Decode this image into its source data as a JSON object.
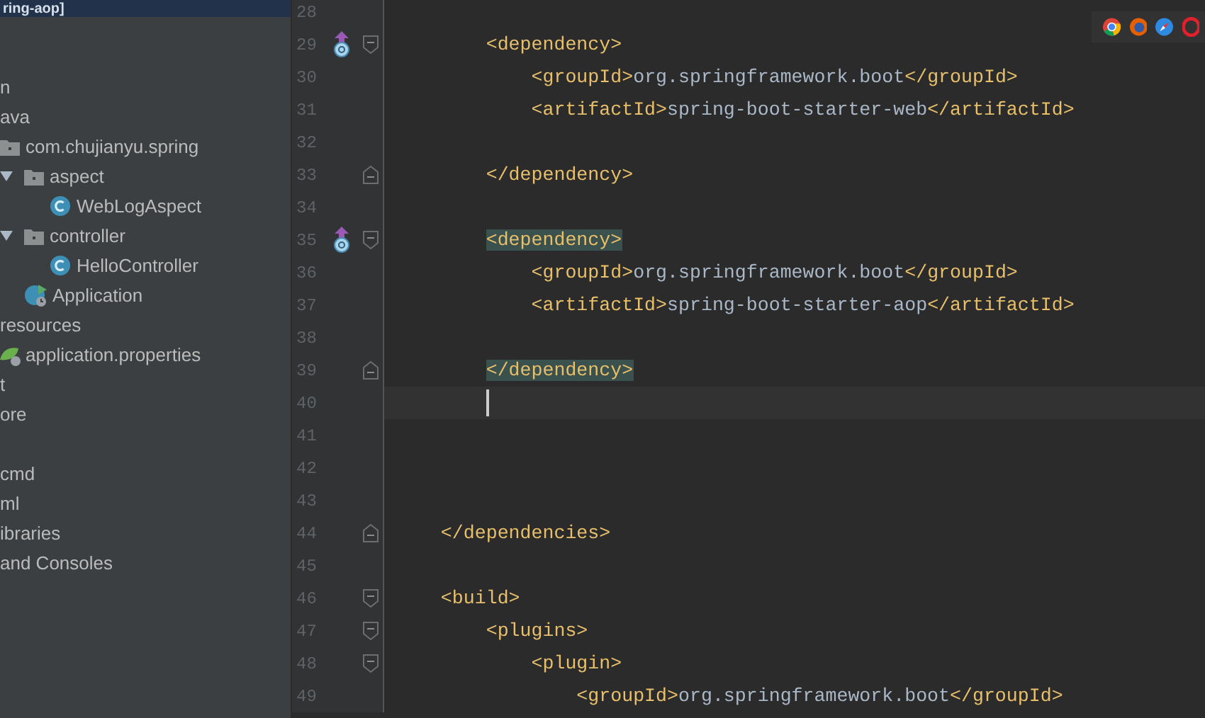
{
  "window": {
    "title": "ring-aop]"
  },
  "project_tree": {
    "items": [
      {
        "label": "n",
        "children": [
          {
            "label": "ava",
            "children": [
              {
                "label": "com.chujianyu.spring",
                "kind": "package",
                "children": [
                  {
                    "label": "aspect",
                    "kind": "package",
                    "expanded": true,
                    "children": [
                      {
                        "label": "WebLogAspect",
                        "kind": "class"
                      }
                    ]
                  },
                  {
                    "label": "controller",
                    "kind": "package",
                    "expanded": true,
                    "children": [
                      {
                        "label": "HelloController",
                        "kind": "class"
                      }
                    ]
                  },
                  {
                    "label": "Application",
                    "kind": "main_class"
                  }
                ]
              }
            ]
          },
          {
            "label": "resources",
            "children": [
              {
                "label": "application.properties",
                "kind": "properties"
              }
            ]
          }
        ]
      },
      {
        "label": "t"
      },
      {
        "label": "ore"
      },
      {
        "label": "cmd",
        "gap_before": true
      },
      {
        "label": "ml"
      },
      {
        "label": "ibraries"
      },
      {
        "label": "and Consoles"
      }
    ]
  },
  "browser_icons": [
    {
      "kind": "chrome"
    },
    {
      "kind": "firefox"
    },
    {
      "kind": "safari"
    },
    {
      "kind": "opera"
    }
  ],
  "editor": {
    "lines": [
      {
        "number": "28"
      },
      {
        "number": "29",
        "gutter_icon": {
          "kind": "override"
        },
        "fold": {
          "kind": "open"
        },
        "segments": [
          {
            "kind": "tag",
            "text": "        <dependency>"
          }
        ]
      },
      {
        "number": "30",
        "segments": [
          {
            "kind": "tag",
            "text": "            <groupId>"
          },
          {
            "kind": "text",
            "text": "org.springframework.boot"
          },
          {
            "kind": "tag",
            "text": "</groupId>"
          }
        ]
      },
      {
        "number": "31",
        "segments": [
          {
            "kind": "tag",
            "text": "            <artifactId>"
          },
          {
            "kind": "text",
            "text": "spring-boot-starter-web"
          },
          {
            "kind": "tag",
            "text": "</artifactId>"
          }
        ]
      },
      {
        "number": "32"
      },
      {
        "number": "33",
        "fold": {
          "kind": "close"
        },
        "segments": [
          {
            "kind": "tag",
            "text": "        </dependency>"
          }
        ]
      },
      {
        "number": "34"
      },
      {
        "number": "35",
        "gutter_icon": {
          "kind": "override"
        },
        "fold": {
          "kind": "open"
        },
        "segments": [
          {
            "kind": "tag",
            "text": "        <dependency>",
            "matched": true
          }
        ]
      },
      {
        "number": "36",
        "segments": [
          {
            "kind": "tag",
            "text": "            <groupId>"
          },
          {
            "kind": "text",
            "text": "org.springframework.boot"
          },
          {
            "kind": "tag",
            "text": "</groupId>"
          }
        ]
      },
      {
        "number": "37",
        "segments": [
          {
            "kind": "tag",
            "text": "            <artifactId>"
          },
          {
            "kind": "text",
            "text": "spring-boot-starter-aop"
          },
          {
            "kind": "tag",
            "text": "</artifactId>"
          }
        ]
      },
      {
        "number": "38"
      },
      {
        "number": "39",
        "fold": {
          "kind": "close"
        },
        "segments": [
          {
            "kind": "tag",
            "text": "        </dependency>",
            "matched": true
          }
        ]
      },
      {
        "number": "40",
        "current": true
      },
      {
        "number": "41"
      },
      {
        "number": "42"
      },
      {
        "number": "43"
      },
      {
        "number": "44",
        "fold": {
          "kind": "close"
        },
        "segments": [
          {
            "kind": "tag",
            "text": "    </dependencies>"
          }
        ]
      },
      {
        "number": "45"
      },
      {
        "number": "46",
        "fold": {
          "kind": "open"
        },
        "segments": [
          {
            "kind": "tag",
            "text": "    <build>"
          }
        ]
      },
      {
        "number": "47",
        "fold": {
          "kind": "open"
        },
        "segments": [
          {
            "kind": "tag",
            "text": "        <plugins>"
          }
        ]
      },
      {
        "number": "48",
        "fold": {
          "kind": "open"
        },
        "segments": [
          {
            "kind": "tag",
            "text": "            <plugin>"
          }
        ]
      },
      {
        "number": "49",
        "segments": [
          {
            "kind": "tag",
            "text": "                <groupId>"
          },
          {
            "kind": "text",
            "text": "org.springframework.boot"
          },
          {
            "kind": "tag",
            "text": "</groupId>"
          }
        ]
      }
    ]
  }
}
